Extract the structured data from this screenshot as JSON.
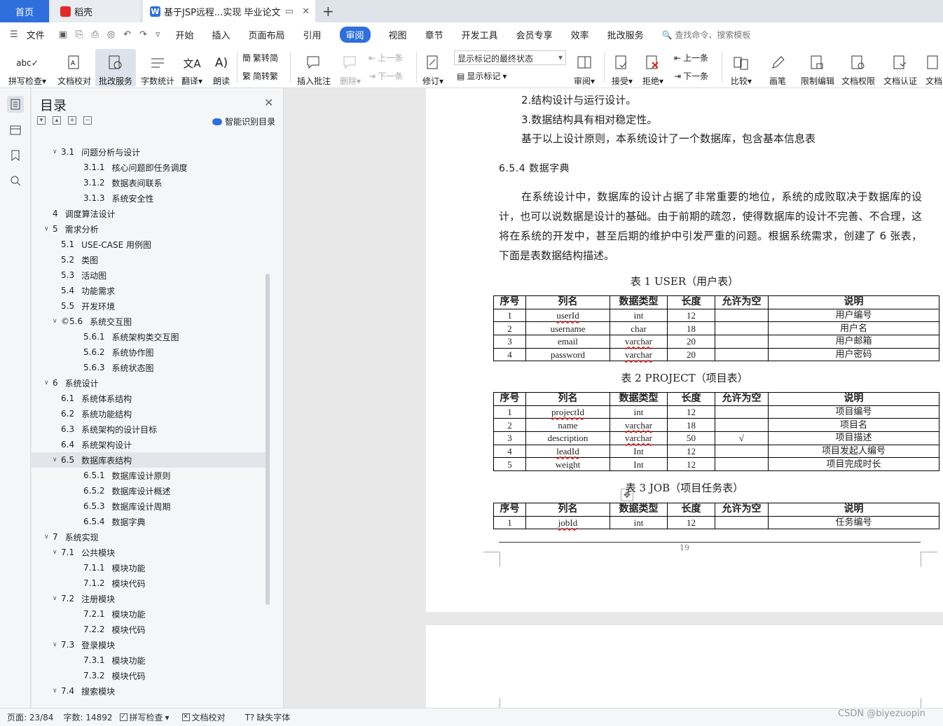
{
  "tabs": {
    "home": "首页",
    "daoke": "稻壳",
    "doc": "基于JSP远程...实现 毕业论文"
  },
  "menu": {
    "file": "文件",
    "items": [
      "开始",
      "插入",
      "页面布局",
      "引用",
      "审阅",
      "视图",
      "章节",
      "开发工具",
      "会员专享",
      "效率",
      "批改服务"
    ],
    "active": "审阅",
    "search": "查找命令、搜索模板"
  },
  "ribbon": {
    "spell": "拼写检查",
    "proof": "文档校对",
    "correct": "批改服务",
    "count": "字数统计",
    "translate": "翻译",
    "read": "朗读",
    "t2s": "繁转简",
    "s2t": "简转繁",
    "add_comment": "插入批注",
    "delete": "删除",
    "prev": "上一条",
    "next": "下一条",
    "revise": "修订",
    "markup_state": "显示标记的最终状态",
    "show_markup": "显示标记",
    "review": "审阅",
    "accept": "接受",
    "reject": "拒绝",
    "prev2": "上一条",
    "next2": "下一条",
    "compare": "比较",
    "pen": "画笔",
    "restrict": "限制编辑",
    "rights": "文档权限",
    "cert": "文档认证",
    "doc_more": "文档"
  },
  "toc": {
    "title": "目录",
    "smart": "智能识别目录",
    "items": [
      {
        "num": "3.1",
        "text": "问题分析与设计",
        "level": 2,
        "arrow": true
      },
      {
        "num": "3.1.1",
        "text": "核心问题即任务调度",
        "level": 3
      },
      {
        "num": "3.1.2",
        "text": "数据表间联系",
        "level": 3
      },
      {
        "num": "3.1.3",
        "text": "系统安全性",
        "level": 3
      },
      {
        "num": "4",
        "text": "调度算法设计",
        "level": 1
      },
      {
        "num": "5",
        "text": "需求分析",
        "level": 1,
        "arrow": true
      },
      {
        "num": "5.1",
        "text": "USE-CASE 用例图",
        "level": 2
      },
      {
        "num": "5.2",
        "text": "类图",
        "level": 2
      },
      {
        "num": "5.3",
        "text": "活动图",
        "level": 2
      },
      {
        "num": "5.4",
        "text": "功能需求",
        "level": 2
      },
      {
        "num": "5.5",
        "text": "开发环境",
        "level": 2
      },
      {
        "num": "©5.6",
        "text": "系统交互图",
        "level": 2,
        "arrow": true
      },
      {
        "num": "5.6.1",
        "text": "系统架构类交互图",
        "level": 3
      },
      {
        "num": "5.6.2",
        "text": "系统协作图",
        "level": 3
      },
      {
        "num": "5.6.3",
        "text": "系统状态图",
        "level": 3
      },
      {
        "num": "6",
        "text": "系统设计",
        "level": 1,
        "arrow": true
      },
      {
        "num": "6.1",
        "text": "系统体系结构",
        "level": 2
      },
      {
        "num": "6.2",
        "text": "系统功能结构",
        "level": 2
      },
      {
        "num": "6.3",
        "text": "系统架构的设计目标",
        "level": 2
      },
      {
        "num": "6.4",
        "text": "系统架构设计",
        "level": 2
      },
      {
        "num": "6.5",
        "text": "数据库表结构",
        "level": 2,
        "arrow": true,
        "selected": true
      },
      {
        "num": "6.5.1",
        "text": "数据库设计原则",
        "level": 3
      },
      {
        "num": "6.5.2",
        "text": "数据库设计概述",
        "level": 3
      },
      {
        "num": "6.5.3",
        "text": "数据库设计周期",
        "level": 3
      },
      {
        "num": "6.5.4",
        "text": "数据字典",
        "level": 3
      },
      {
        "num": "7",
        "text": "系统实现",
        "level": 1,
        "arrow": true
      },
      {
        "num": "7.1",
        "text": "公共模块",
        "level": 2,
        "arrow": true
      },
      {
        "num": "7.1.1",
        "text": "模块功能",
        "level": 3
      },
      {
        "num": "7.1.2",
        "text": "模块代码",
        "level": 3
      },
      {
        "num": "7.2",
        "text": "注册模块",
        "level": 2,
        "arrow": true
      },
      {
        "num": "7.2.1",
        "text": "模块功能",
        "level": 3
      },
      {
        "num": "7.2.2",
        "text": "模块代码",
        "level": 3
      },
      {
        "num": "7.3",
        "text": "登录模块",
        "level": 2,
        "arrow": true
      },
      {
        "num": "7.3.1",
        "text": "模块功能",
        "level": 3
      },
      {
        "num": "7.3.2",
        "text": "模块代码",
        "level": 3
      },
      {
        "num": "7.4",
        "text": "搜索模块",
        "level": 2,
        "arrow": true
      }
    ]
  },
  "doc": {
    "line1": "2.结构设计与运行设计。",
    "line2": "3.数据结构具有相对稳定性。",
    "line3": "基于以上设计原则，本系统设计了一个数据库，包含基本信息表",
    "heading": "6.5.4   数据字典",
    "para": "在系统设计中，数据库的设计占据了非常重要的地位，系统的成败取决于数据库的设计，也可以说数据是设计的基础。由于前期的疏忽，使得数据库的设计不完善、不合理，这将在系统的开发中，甚至后期的维护中引发严重的问题。根据系统需求，创建了 6 张表，下面是表数据结构描述。",
    "headers": [
      "序号",
      "列名",
      "数据类型",
      "长度",
      "允许为空",
      "说明"
    ],
    "table1": {
      "caption": "表 1     USER（用户表）",
      "rows": [
        [
          "1",
          "userId",
          "int",
          "12",
          "",
          "用户编号"
        ],
        [
          "2",
          "username",
          "char",
          "18",
          "",
          "用户名"
        ],
        [
          "3",
          "email",
          "varchar",
          "20",
          "",
          "用户邮箱"
        ],
        [
          "4",
          "password",
          "varchar",
          "20",
          "",
          "用户密码"
        ]
      ]
    },
    "table2": {
      "caption": "表 2   PROJECT（项目表）",
      "rows": [
        [
          "1",
          "projectId",
          "int",
          "12",
          "",
          "项目编号"
        ],
        [
          "2",
          "name",
          "varchar",
          "18",
          "",
          "项目名"
        ],
        [
          "3",
          "description",
          "varchar",
          "50",
          "√",
          "项目描述"
        ],
        [
          "4",
          "leadId",
          "Int",
          "12",
          "",
          "项目发起人编号"
        ],
        [
          "5",
          "weight",
          "Int",
          "12",
          "",
          "项目完成时长"
        ]
      ]
    },
    "table3": {
      "caption": "表 3   JOB（项目任务表）",
      "rows": [
        [
          "1",
          "jobId",
          "int",
          "12",
          "",
          "任务编号"
        ]
      ]
    },
    "page_number": "19"
  },
  "status": {
    "page": "页面: 23/84",
    "words": "字数: 14892",
    "spell": "拼写检查",
    "proof": "文档校对",
    "font": "缺失字体"
  },
  "watermark": "CSDN @biyezuopin"
}
